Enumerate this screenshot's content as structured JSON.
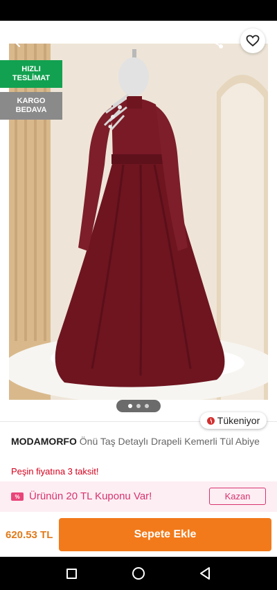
{
  "badges": {
    "fast_line1": "HIZLI",
    "fast_line2": "TESLİMAT",
    "free_line1": "KARGO",
    "free_line2": "BEDAVA"
  },
  "gallery": {
    "image_count": 3,
    "active_index": 0
  },
  "stock_label": "Tükeniyor",
  "product": {
    "brand": "MODAMORFO",
    "name": "Önü Taş Detaylı Drapeli Kemerli Tül Abiye",
    "installment_text": "Peşin fiyatına 3 taksit!"
  },
  "coupon": {
    "icon_text": "%",
    "text": "Ürünün 20 TL Kuponu Var!",
    "button_label": "Kazan"
  },
  "purchase": {
    "price": "620.53 TL",
    "add_to_cart_label": "Sepete Ekle"
  },
  "colors": {
    "accent_orange": "#f27a1a",
    "badge_green": "#12a150",
    "badge_gray": "#8a8a8a",
    "coupon_pink": "#d6336c",
    "installment_red": "#d6001c",
    "dress_burgundy": "#6e1520"
  },
  "icons": {
    "back": "arrow-left-icon",
    "share": "share-icon",
    "favorite": "heart-outline-icon",
    "stock": "clock-icon",
    "coupon": "coupon-icon",
    "nav_recents": "square-icon",
    "nav_home": "circle-icon",
    "nav_back": "triangle-back-icon"
  }
}
